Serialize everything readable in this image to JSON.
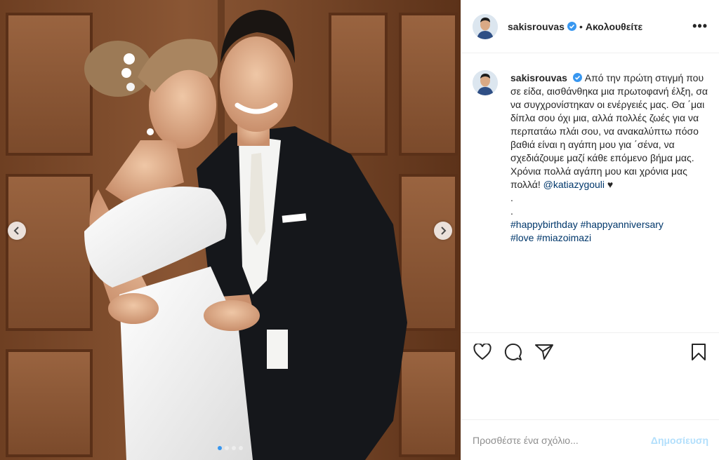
{
  "post": {
    "username": "sakisrouvas",
    "separator": "•",
    "follow_label": "Ακολουθείτε",
    "more_label": "•••",
    "caption": {
      "username": "sakisrouvas",
      "text": "Από την πρώτη στιγμή που σε είδα, αισθάνθηκα μια πρωτοφανή έλξη, σα να συγχρονίστηκαν οι ενέργειές μας. Θα ΄μαι δίπλα σου όχι μια, αλλά πολλές ζωές για να περπατάω πλάι σου, να ανακαλύπτω πόσο βαθιά είναι η αγάπη μου για ΄σένα, να σχεδιάζουμε μαζί κάθε επόμενο βήμα μας. Χρόνια πολλά αγάπη μου και χρόνια μας πολλά!",
      "mention": "@katiazygouli",
      "heart": "♥",
      "dot1": ".",
      "dot2": ".",
      "hashtags": [
        "#happybirthday",
        "#happyanniversary",
        "#love",
        "#miazoimazi"
      ]
    },
    "carousel": {
      "total_slides": 4,
      "active_slide": 1
    },
    "comment": {
      "placeholder": "Προσθέστε ένα σχόλιο...",
      "post_label": "Δημοσίευση"
    },
    "colors": {
      "accent": "#3897f0",
      "link": "#00376b",
      "post_disabled": "#b2dffc"
    }
  }
}
